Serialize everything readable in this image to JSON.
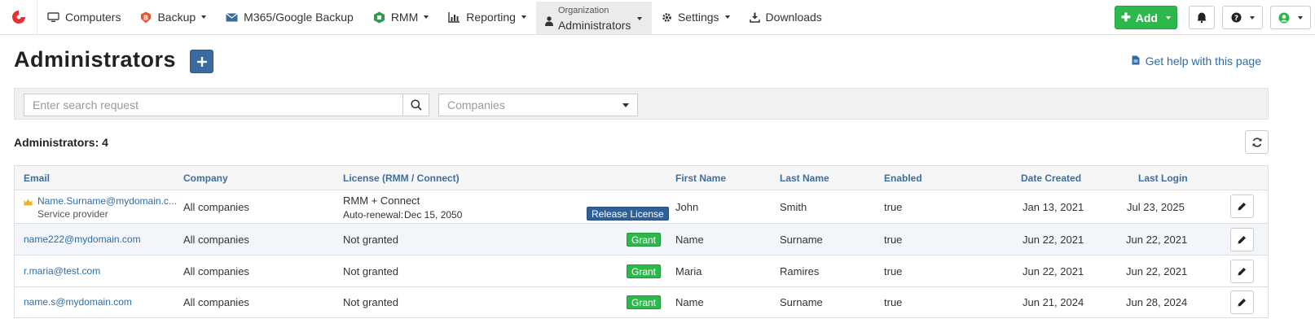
{
  "nav": {
    "items": [
      {
        "label": "Computers",
        "icon": "monitor-icon"
      },
      {
        "label": "Backup",
        "icon": "backup-shield-icon"
      },
      {
        "label": "M365/Google Backup",
        "icon": "envelope-icon"
      },
      {
        "label": "RMM",
        "icon": "rmm-icon"
      },
      {
        "label": "Reporting",
        "icon": "bar-chart-icon"
      }
    ],
    "organization": {
      "small": "Organization",
      "label": "Administrators"
    },
    "settings": "Settings",
    "downloads": "Downloads",
    "add_label": "Add"
  },
  "page": {
    "title": "Administrators",
    "help": "Get help with this page",
    "search_placeholder": "Enter search request",
    "companies_placeholder": "Companies",
    "count": "Administrators: 4"
  },
  "table": {
    "headers": {
      "email": "Email",
      "company": "Company",
      "license": "License (RMM / Connect)",
      "first": "First Name",
      "last": "Last Name",
      "enabled": "Enabled",
      "created": "Date Created",
      "login": "Last Login"
    },
    "rows": [
      {
        "email": "Name.Surname@mydomain.c...",
        "role": "Service provider",
        "company": "All companies",
        "license": "RMM + Connect",
        "renewal_label": "Auto-renewal:",
        "renewal_date": "Dec 15, 2050",
        "action": "Release License",
        "first": "John",
        "last": "Smith",
        "enabled": "true",
        "created": "Jan 13, 2021",
        "login": "Jul 23, 2025"
      },
      {
        "email": "name222@mydomain.com",
        "company": "All companies",
        "license": "Not granted",
        "action": "Grant",
        "first": "Name",
        "last": "Surname",
        "enabled": "true",
        "created": "Jun 22, 2021",
        "login": "Jun 22, 2021"
      },
      {
        "email": "r.maria@test.com",
        "company": "All companies",
        "license": "Not granted",
        "action": "Grant",
        "first": "Maria",
        "last": "Ramires",
        "enabled": "true",
        "created": "Jun 22, 2021",
        "login": "Jun 22, 2021"
      },
      {
        "email": "name.s@mydomain.com",
        "company": "All companies",
        "license": "Not granted",
        "action": "Grant",
        "first": "Name",
        "last": "Surname",
        "enabled": "true",
        "created": "Jun 21, 2024",
        "login": "Jun 28, 2024"
      }
    ]
  },
  "colors": {
    "accent": "#2e6da4",
    "green": "#2db84b",
    "brand": "#e8312f"
  }
}
